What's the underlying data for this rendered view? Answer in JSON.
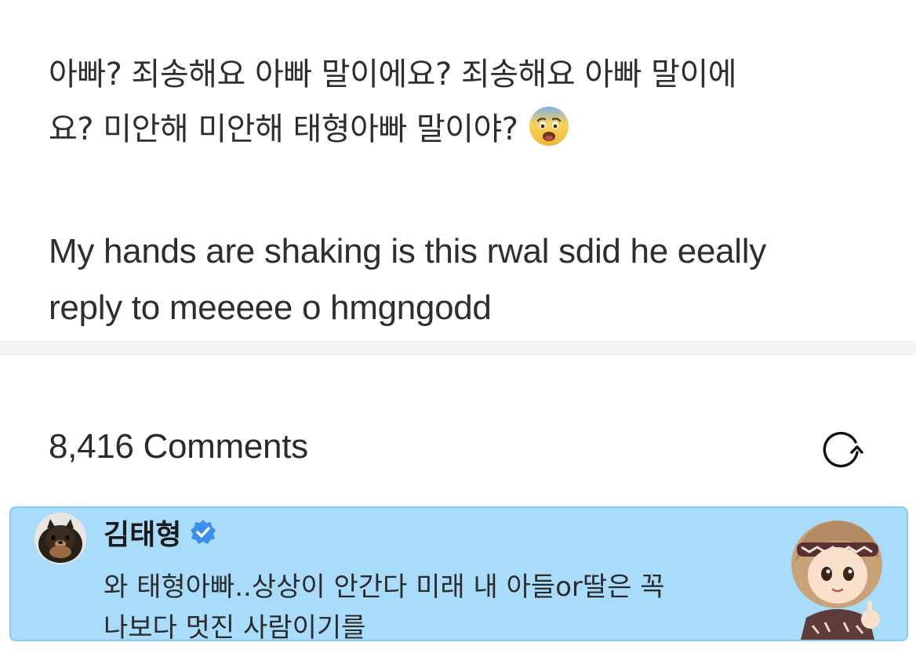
{
  "post": {
    "line1": "아빠?  죄송해요 아빠 말이에요?  죄송해요 아빠 말이에",
    "line2": "요?  미안해 미안해 태형아빠 말이야?",
    "emoji_name": "anxious-face-with-sweat",
    "en_line1": "My hands are shaking is this rwal sdid he eeally",
    "en_line2": "reply to meeeee o hmgngodd"
  },
  "comments": {
    "count_label": "8,416 Comments",
    "refresh_icon": "refresh-icon"
  },
  "highlighted_comment": {
    "author": "김태형",
    "verified_icon": "verified-badge-icon",
    "text_line1": "와 태형아빠..상상이 안간다 미래 내 아들or딸은 꼭",
    "text_line2": "나보다 멋진 사람이기를",
    "background_color": "#a8dcfa",
    "verified_color": "#3b8ff0"
  }
}
